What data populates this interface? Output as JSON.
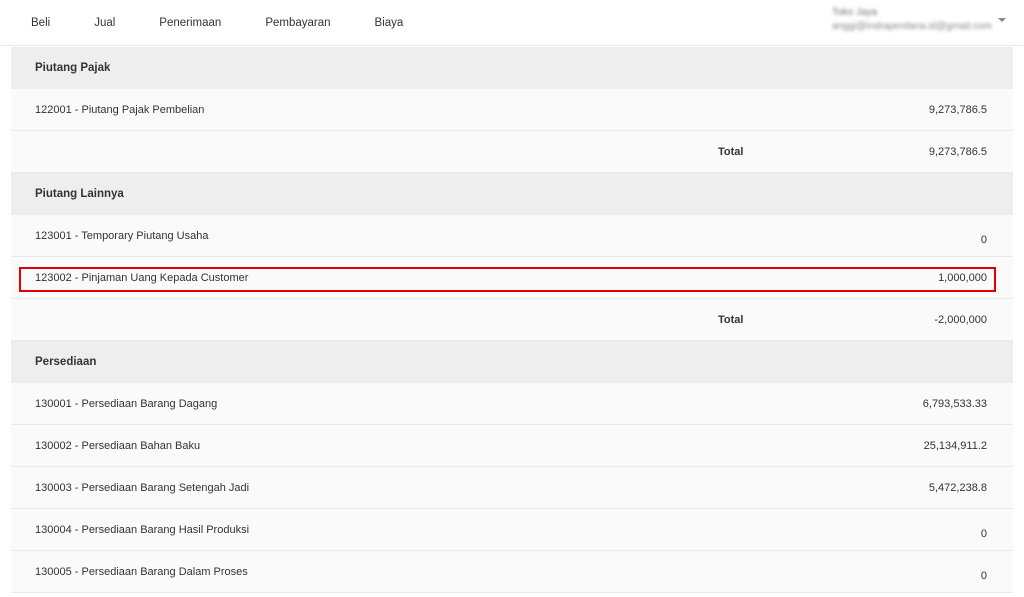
{
  "nav": {
    "items": [
      "Beli",
      "Jual",
      "Penerimaan",
      "Pembayaran",
      "Biaya"
    ]
  },
  "user": {
    "name": "Toko Jaya",
    "email": "anggi@indraperdana.id@gmail.com"
  },
  "sections": {
    "piutang_pajak": {
      "title": "Piutang Pajak",
      "rows": [
        {
          "label": "122001 - Piutang Pajak Pembelian",
          "amount": "9,273,786.5"
        }
      ],
      "total_label": "Total",
      "total": "9,273,786.5"
    },
    "piutang_lainnya": {
      "title": "Piutang Lainnya",
      "rows": [
        {
          "label": "123001 - Temporary Piutang Usaha",
          "amount": "0"
        },
        {
          "label": "123002 - Pinjaman Uang Kepada Customer",
          "amount": "1,000,000"
        }
      ],
      "total_label": "Total",
      "total": "-2,000,000"
    },
    "persediaan": {
      "title": "Persediaan",
      "rows": [
        {
          "label": "130001 - Persediaan Barang Dagang",
          "amount": "6,793,533.33"
        },
        {
          "label": "130002 - Persediaan Bahan Baku",
          "amount": "25,134,911.2"
        },
        {
          "label": "130003 - Persediaan Barang Setengah Jadi",
          "amount": "5,472,238.8"
        },
        {
          "label": "130004 - Persediaan Barang Hasil Produksi",
          "amount": "0"
        },
        {
          "label": "130005 - Persediaan Barang Dalam Proses",
          "amount": "0"
        }
      ]
    }
  },
  "colors": {
    "highlight": "#e00000",
    "section_bg": "#eeeeee",
    "row_bg": "#fafafa"
  },
  "icons": {
    "user_menu": "chevron-down-icon"
  }
}
